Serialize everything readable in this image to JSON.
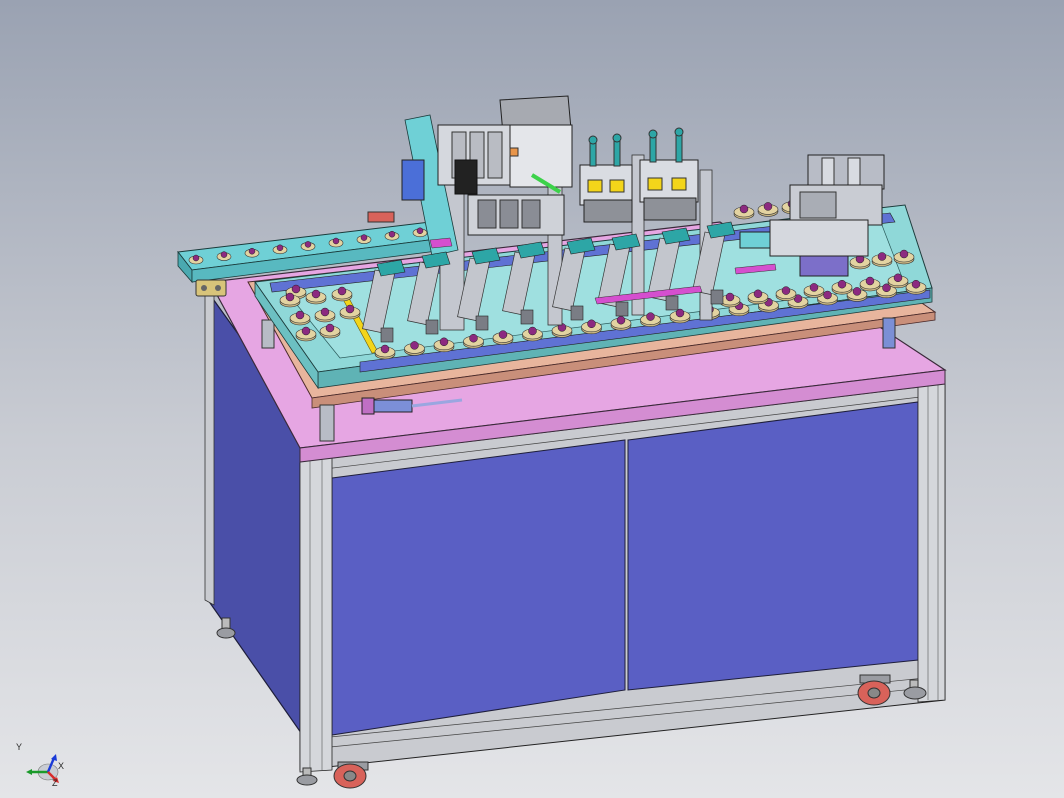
{
  "viewport": {
    "background_top": "#9aa2b2",
    "background_bottom": "#e4e5e8"
  },
  "colors": {
    "cabinet_panel": "#5a5fc4",
    "cabinet_panel_dark": "#4a4fa8",
    "table_top": "#e6a6e3",
    "frame_profile": "#c9cbd0",
    "conveyor": "#6fd0d6",
    "fixture_teal": "#8fd8d8",
    "puck": "#e3d3a1",
    "puck_center": "#8c2a80",
    "accent_yellow": "#f3d51a",
    "caster_red": "#d8625a"
  },
  "coordinate_triad": {
    "x_label": "X",
    "y_label": "Y",
    "z_label": "Z"
  }
}
